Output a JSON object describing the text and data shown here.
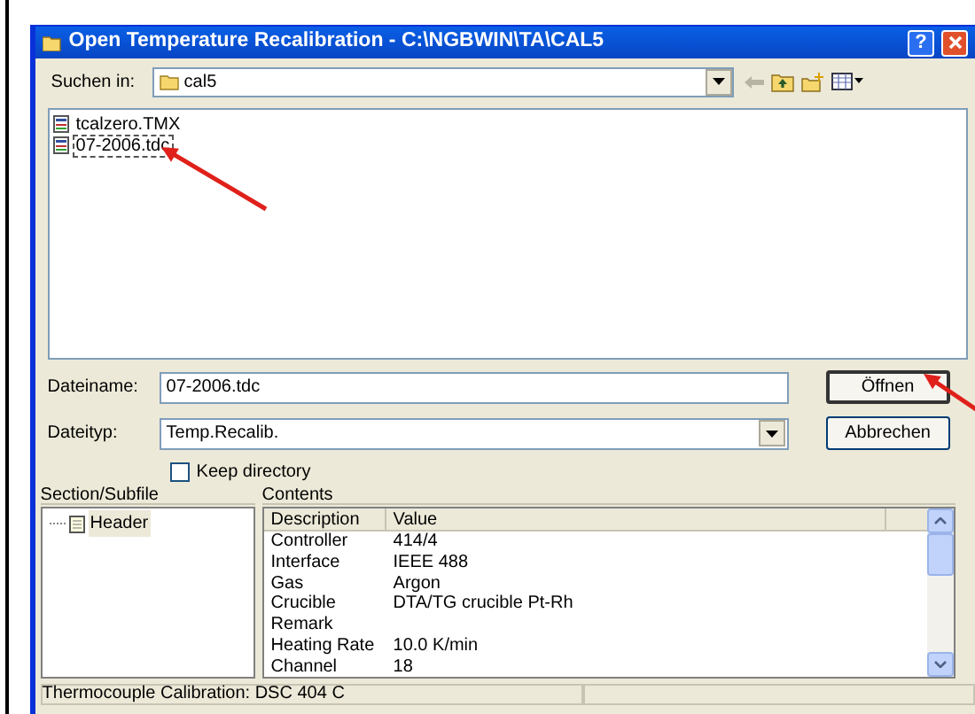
{
  "window": {
    "title": "Open Temperature Recalibration - C:\\NGBWIN\\TA\\CAL5",
    "help": "?"
  },
  "look_in": {
    "label": "Suchen in:",
    "value": "cal5"
  },
  "files": [
    {
      "name": "tcalzero.TMX",
      "selected": false
    },
    {
      "name": "07-2006.tdc",
      "selected": true
    }
  ],
  "filename": {
    "label": "Dateiname:",
    "value": "07-2006.tdc"
  },
  "filetype": {
    "label": "Dateityp:",
    "value": "Temp.Recalib."
  },
  "buttons": [
    {
      "label": "Öffnen",
      "default": true
    },
    {
      "label": "Abbrechen",
      "default": false
    }
  ],
  "keep_directory": {
    "label": "Keep directory",
    "checked": false
  },
  "section": {
    "title": "Section/Subfile",
    "items": [
      {
        "label": "Header",
        "selected": true
      }
    ]
  },
  "contents": {
    "title": "Contents",
    "columns": [
      "Description",
      "Value"
    ],
    "rows": [
      [
        "Controller",
        "414/4"
      ],
      [
        "Interface",
        "IEEE 488"
      ],
      [
        "Gas",
        "Argon"
      ],
      [
        "Crucible",
        "DTA/TG crucible Pt-Rh"
      ],
      [
        "Remark"
      ],
      [
        "Heating Rate",
        "10.0 K/min"
      ],
      [
        "Channel",
        "18"
      ]
    ]
  },
  "status_bar": [
    "Thermocouple Calibration: DSC 404 C"
  ]
}
